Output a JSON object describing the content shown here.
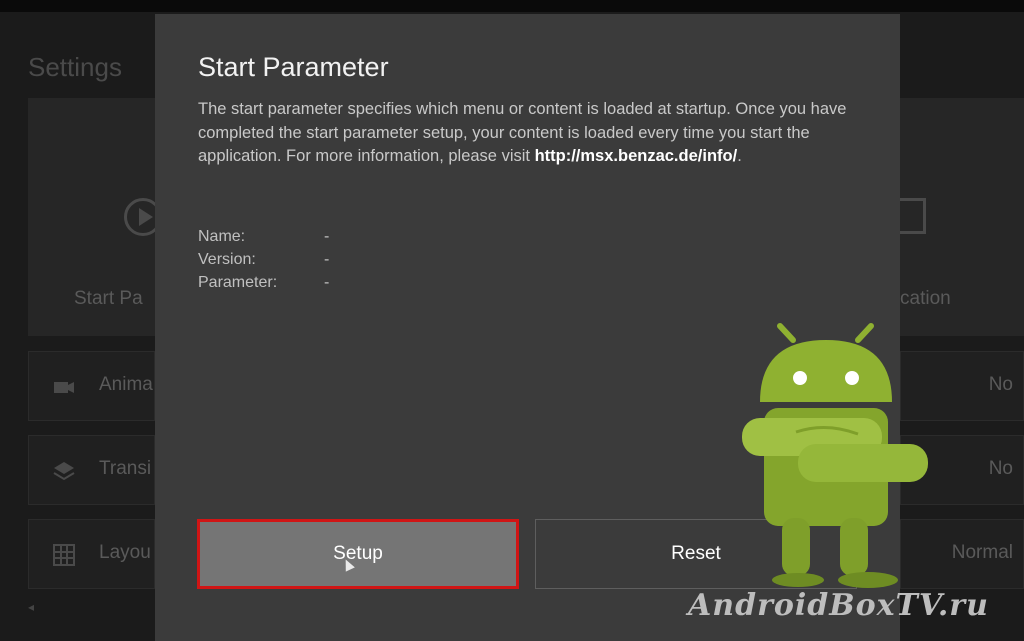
{
  "background": {
    "title": "Settings",
    "tiles": [
      {
        "label": "Start Pa",
        "icon": "play-circle-icon"
      },
      {
        "label": "cation",
        "icon": "exit-icon"
      }
    ],
    "rows": [
      {
        "label": "Anima",
        "icon": "camera-icon",
        "value": "No"
      },
      {
        "label": "Transi",
        "icon": "layers-icon",
        "value": "No"
      },
      {
        "label": "Layou",
        "icon": "grid-icon",
        "value": "Normal"
      }
    ]
  },
  "dialog": {
    "title": "Start Parameter",
    "description": "The start parameter specifies which menu or content is loaded at startup. Once you have completed the start parameter setup, your content is loaded every time you start the application. For more information, please visit ",
    "link": "http://msx.benzac.de/info/",
    "description_end": ".",
    "info": [
      {
        "label": "Name:",
        "value": "-"
      },
      {
        "label": "Version:",
        "value": "-"
      },
      {
        "label": "Parameter:",
        "value": "-"
      }
    ],
    "buttons": {
      "setup": "Setup",
      "reset": "Reset"
    }
  },
  "watermark": "AndroidBoxTV.ru",
  "colors": {
    "highlight": "#d01515",
    "dialog_bg": "#3b3b3b",
    "droid_green": "#8fb131"
  }
}
